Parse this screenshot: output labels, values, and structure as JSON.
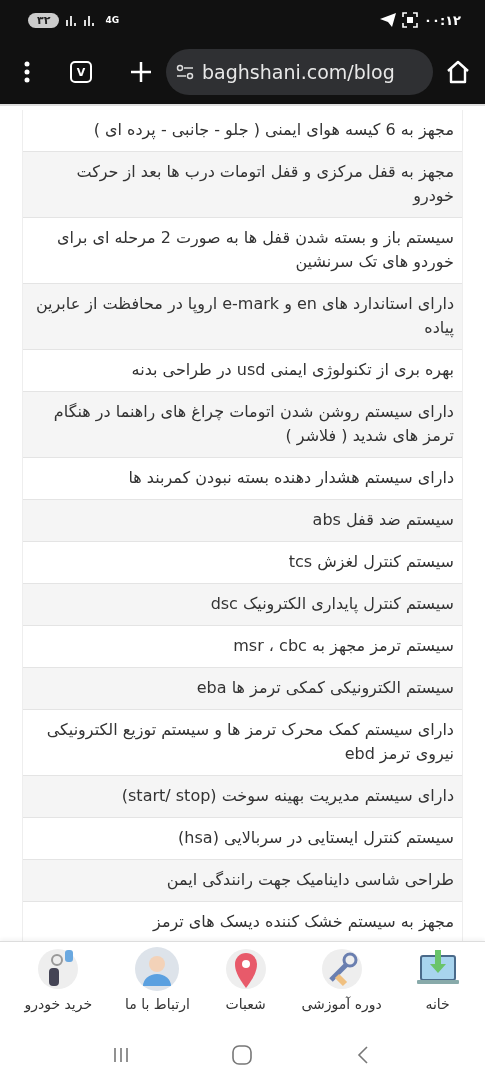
{
  "status_bar": {
    "battery": "۳۲",
    "network": "4G",
    "time": "۰۰:۱۲"
  },
  "browser": {
    "url": "baghshani.com/blog",
    "tab_count": "V"
  },
  "features": [
    {
      "text": "مجهز به 6 کیسه هوای ایمنی ( جلو -  جانبی - پرده ای )"
    },
    {
      "text": "مجهز به قفل مرکزی و قفل اتومات درب ها بعد از حرکت خودرو"
    },
    {
      "text": "سیستم باز و بسته شدن قفل ها به صورت 2 مرحله ای برای خوردو های تک سرنشین"
    },
    {
      "text": "دارای استاندارد های en و e-mark اروپا در محافظت از عابرین پیاده"
    },
    {
      "text": "بهره بری از تکنولوژی ایمنی usd در طراحی بدنه"
    },
    {
      "text": "دارای سیستم روشن شدن اتومات چراغ های راهنما در هنگام ترمز های شدید ( فلاشر )"
    },
    {
      "text": "دارای سیستم هشدار دهنده بسته نبودن کمربند ها"
    },
    {
      "text": "سیستم ضد قفل abs"
    },
    {
      "text": "سیستم کنترل لغزش  tcs"
    },
    {
      "text": "سیستم کنترل پایداری الکترونیک dsc"
    },
    {
      "text": "سیستم ترمز مجهز به msr ، cbc"
    },
    {
      "text": "سیستم الکترونیکی کمکی ترمز ها eba"
    },
    {
      "text": "دارای سیستم کمک محرک ترمز ها و سیستم توزیع الکترونیکی نیروی ترمز ebd"
    },
    {
      "text": "دارای سیستم مدیریت بهینه سوخت (start/ stop)"
    },
    {
      "text": "سیستم کنترل ایستایی در سربالایی (hsa)"
    },
    {
      "text": "طراحی شاسی داینامیک جهت رانندگی ایمن"
    },
    {
      "text": "مجهز به سیستم خشک کننده دیسک های ترمز"
    }
  ],
  "bottom_nav": [
    {
      "kind": "home",
      "label": "خانه"
    },
    {
      "kind": "course",
      "label": "دوره آموزشی"
    },
    {
      "kind": "branches",
      "label": "شعبات"
    },
    {
      "kind": "contact",
      "label": "ارتباط با ما"
    },
    {
      "kind": "buy",
      "label": "خرید خودرو"
    }
  ]
}
